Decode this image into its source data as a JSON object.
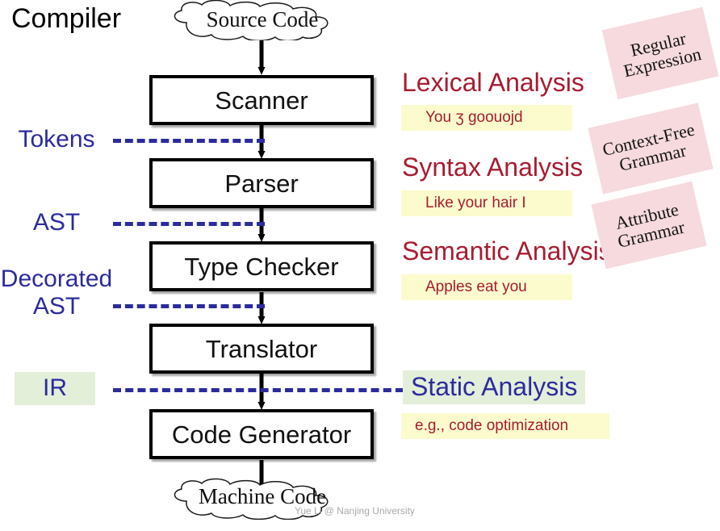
{
  "title": "Compiler",
  "watermark": "Yue Li @ Nanjing University",
  "colors": {
    "box_border": "#000000",
    "phase_title": "#a71c30",
    "ir_blue": "#2b2b9e",
    "example_bg": "#fbfbcd",
    "formalism_bg": "#f6dadd",
    "static_bg": "#e3efd9",
    "watermark": "#a9a9a9"
  },
  "input_cloud": {
    "label": "Source Code"
  },
  "output_cloud": {
    "label": "Machine Code"
  },
  "stages": [
    {
      "label": "Scanner"
    },
    {
      "label": "Parser"
    },
    {
      "label": "Type Checker"
    },
    {
      "label": "Translator"
    },
    {
      "label": "Code Generator"
    }
  ],
  "intermediate_results": [
    {
      "label": "Tokens",
      "highlighted": false
    },
    {
      "label": "AST",
      "highlighted": false
    },
    {
      "label_line1": "Decorated",
      "label_line2": "AST",
      "highlighted": false
    },
    {
      "label": "IR",
      "highlighted": true
    }
  ],
  "phases": [
    {
      "title": "Lexical Analysis",
      "example": "You ʒ goouojd"
    },
    {
      "title": "Syntax Analysis",
      "example": "Like your hair I"
    },
    {
      "title": "Semantic Analysis",
      "example": "Apples eat you"
    },
    {
      "title": "Static Analysis",
      "example": "e.g., code optimization"
    }
  ],
  "formalisms": [
    {
      "line1": "Regular",
      "line2": "Expression"
    },
    {
      "line1": "Context-Free",
      "line2": "Grammar"
    },
    {
      "line1": "Attribute",
      "line2": "Grammar"
    }
  ]
}
